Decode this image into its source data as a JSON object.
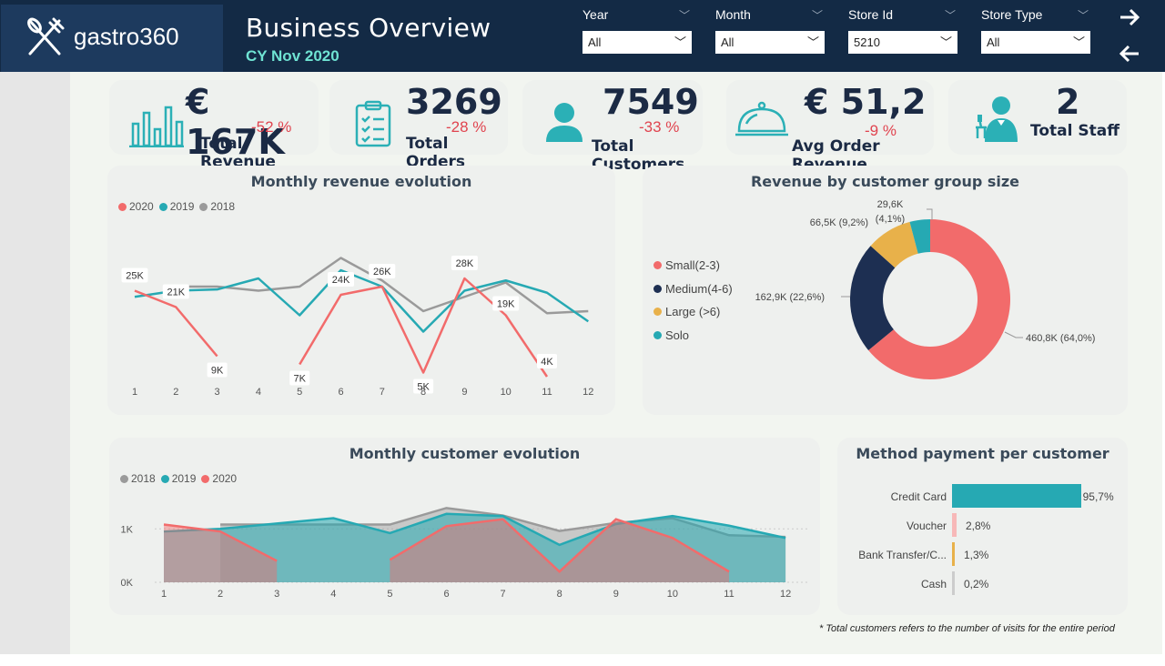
{
  "header": {
    "logo_text": "gastro360",
    "title": "Business Overview",
    "subtitle": "CY Nov 2020",
    "filters": [
      {
        "label": "Year",
        "value": "All"
      },
      {
        "label": "Month",
        "value": "All"
      },
      {
        "label": "Store Id",
        "value": "5210"
      },
      {
        "label": "Store Type",
        "value": "All"
      }
    ],
    "forward_icon": "arrow-right-icon",
    "back_icon": "arrow-left-icon"
  },
  "kpis": [
    {
      "value": "€ 167K",
      "delta": "-52 %",
      "label": "Total Revenue",
      "icon": "bar-chart-icon"
    },
    {
      "value": "3269",
      "delta": "-28 %",
      "label": "Total Orders",
      "icon": "clipboard-icon"
    },
    {
      "value": "7549",
      "delta": "-33 %",
      "label": "Total Customers",
      "icon": "person-icon"
    },
    {
      "value": "€ 51,2",
      "delta": "-9 %",
      "label": "Avg Order Revenue",
      "icon": "cloche-icon"
    },
    {
      "value": "2",
      "delta": "",
      "label": "Total Staff",
      "icon": "waiter-icon"
    }
  ],
  "colors": {
    "red": "#f26b6b",
    "teal": "#26a9b3",
    "gray": "#9a9a9a",
    "navy": "#1d2f52",
    "gold": "#e8b14a",
    "accent_green": "#6fe3d3",
    "delta_red": "#e0444f"
  },
  "chart_data": [
    {
      "type": "line",
      "title": "Monthly revenue evolution",
      "x": [
        1,
        2,
        3,
        4,
        5,
        6,
        7,
        8,
        9,
        10,
        11,
        12
      ],
      "series": [
        {
          "name": "2020",
          "color": "#f26b6b",
          "values": [
            25,
            21,
            9,
            null,
            7,
            24,
            26,
            5,
            28,
            19,
            4,
            null
          ],
          "labels": [
            "25K",
            "21K",
            "9K",
            "",
            "7K",
            "24K",
            "26K",
            "5K",
            "28K",
            "19K",
            "4K",
            ""
          ]
        },
        {
          "name": "2019",
          "color": "#26a9b3",
          "values": [
            23.5,
            25,
            25.3,
            28,
            19,
            30,
            26,
            15,
            25,
            27.5,
            24.5,
            17.5
          ]
        },
        {
          "name": "2018",
          "color": "#9a9a9a",
          "values": [
            null,
            26,
            26,
            25,
            26,
            33,
            27.5,
            20,
            23.5,
            27,
            19.5,
            20
          ]
        }
      ],
      "ylim": [
        0,
        40
      ]
    },
    {
      "type": "pie",
      "title": "Revenue by customer group size",
      "categories": [
        "Small(2-3)",
        "Medium(4-6)",
        "Large (>6)",
        "Solo"
      ],
      "values": [
        460.8,
        162.9,
        66.5,
        29.6
      ],
      "labels": [
        "460,8K (64,0%)",
        "162,9K (22,6%)",
        "66,5K (9,2%)",
        "29,6K (4,1%)"
      ],
      "label_parts": {
        "solo_top": "29,6K",
        "solo_bottom": "(4,1%)"
      },
      "colors": [
        "#f26b6b",
        "#1d2f52",
        "#e8b14a",
        "#26a9b3"
      ]
    },
    {
      "type": "area",
      "title": "Monthly customer evolution",
      "x": [
        1,
        2,
        3,
        4,
        5,
        6,
        7,
        8,
        9,
        10,
        11,
        12
      ],
      "series": [
        {
          "name": "2018",
          "color": "#9a9a9a",
          "values": [
            null,
            1080,
            1080,
            1080,
            1080,
            1390,
            1250,
            960,
            1110,
            1200,
            880,
            850
          ]
        },
        {
          "name": "2019",
          "color": "#26a9b3",
          "values": [
            950,
            1000,
            1100,
            1200,
            920,
            1280,
            1240,
            700,
            1090,
            1240,
            1060,
            830
          ]
        },
        {
          "name": "2020",
          "color": "#f26b6b",
          "values": [
            1080,
            950,
            400,
            null,
            420,
            1050,
            1180,
            200,
            1180,
            830,
            200,
            null
          ]
        }
      ],
      "yticks": [
        "0K",
        "1K"
      ],
      "ylim": [
        0,
        1600
      ]
    },
    {
      "type": "bar",
      "title": "Method payment per customer",
      "categories": [
        "Credit Card",
        "Voucher",
        "Bank Transfer/C...",
        "Cash"
      ],
      "values": [
        95.7,
        2.8,
        1.3,
        0.2
      ],
      "labels": [
        "95,7%",
        "2,8%",
        "1,3%",
        "0,2%"
      ],
      "colors": [
        "#26a9b3",
        "#f7b8b8",
        "#e8b14a",
        "#cccccc"
      ]
    }
  ],
  "footnote": "* Total customers refers to the number of visits for the entire period"
}
